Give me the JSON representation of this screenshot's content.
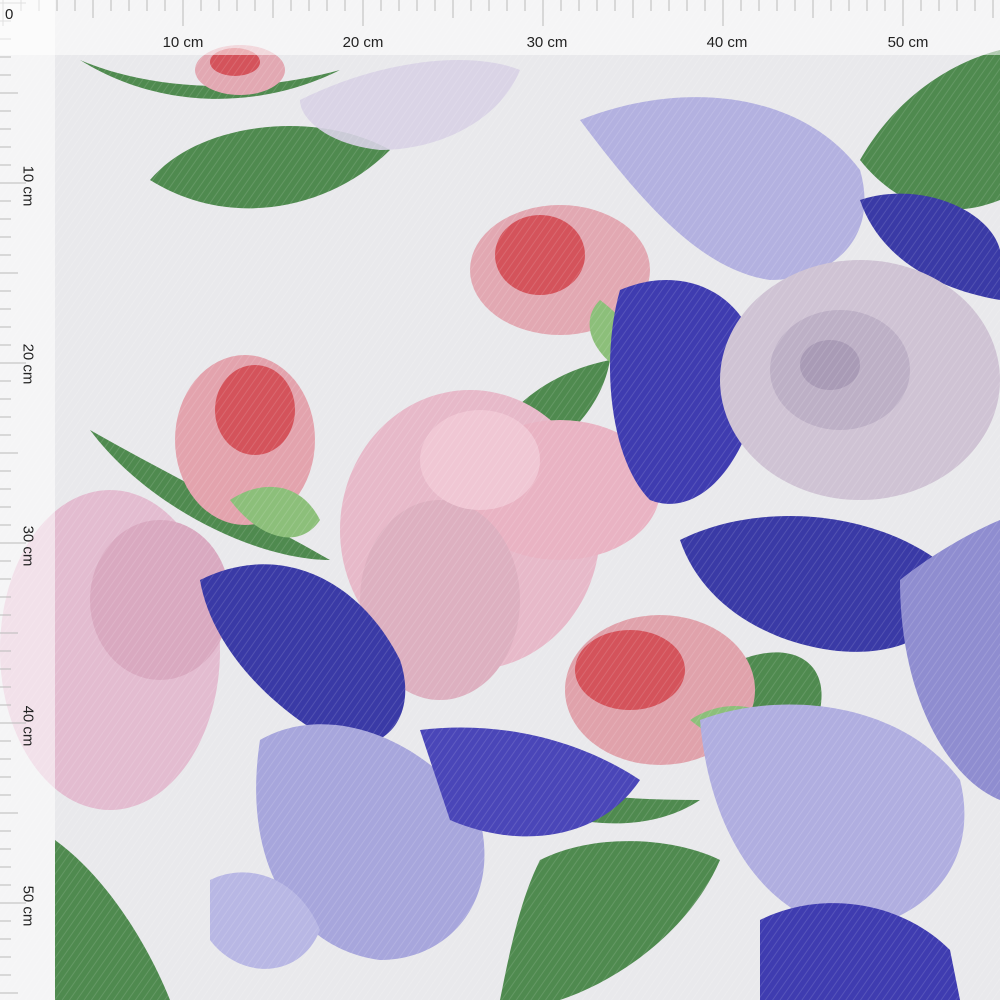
{
  "ruler": {
    "zero": "0",
    "top_labels": [
      "10 cm",
      "20 cm",
      "30 cm",
      "40 cm",
      "50 cm"
    ],
    "left_labels": [
      "10 cm",
      "20 cm",
      "30 cm",
      "40 cm",
      "50 cm"
    ]
  },
  "colors": {
    "background": "#e9e9ec",
    "iris_dark": "#3a3aa6",
    "iris_light": "#a7a6dc",
    "rose_pink": "#e7b9c9",
    "rosebud_red": "#d4535b",
    "leaf_green": "#4f8a4f",
    "rose_lavender": "#cfc3d4"
  }
}
